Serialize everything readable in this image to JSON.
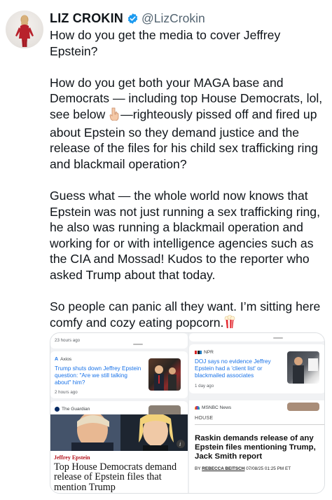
{
  "author": {
    "name": "LIZ CROKIN",
    "handle": "@LizCrokin",
    "verified": true
  },
  "tweet": {
    "paragraphs": [
      "How do you get the media to cover Jeffrey Epstein?",
      "How do you get both your MAGA base and Democrats — including top House Democrats, lol, see below ",
      "Guess what — the whole world now knows that Epstein was not just running a sex trafficking ring, he also was running a blackmail operation and working for or with intelligence agencies such as the CIA and Mossad! Kudos to the reporter who asked Trump about that today.",
      "So people can panic all they want. I’m sitting here comfy and cozy eating popcorn."
    ],
    "para2_tail": "—righteously pissed off and fired up about Epstein so they demand justice and the release of the files for his child sex trafficking ring and blackmail operation?",
    "emoji_pointing": "pointing-down-emoji",
    "emoji_popcorn": "popcorn-emoji"
  },
  "screenshot": {
    "left": {
      "top_time": "23 hours ago",
      "axios": {
        "source": "Axios",
        "headline": "Trump shuts down Jeffrey Epstein question: \"Are we still talking about\" him?",
        "time": "2 hours ago"
      },
      "guardian_source": "The Guardian",
      "article": {
        "kicker": "Jeffrey Epstein",
        "headline": "Top House Democrats demand release of Epstein files that mention Trump"
      }
    },
    "right": {
      "npr": {
        "source": "NPR",
        "headline": "DOJ says no evidence Jeffrey Epstein had a 'client list' or blackmailed associates",
        "time": "1 day ago"
      },
      "msnbc": {
        "source": "MSNBC News",
        "section": "HOUSE",
        "headline": "Raskin demands release of any Epstein files mentioning Trump, Jack Smith report",
        "byline_prefix": "BY",
        "byline_author": "REBECCA BEITSCH",
        "byline_date": "07/08/25 01:25 PM ET"
      }
    }
  },
  "colors": {
    "text": "#0f1419",
    "handle": "#536471",
    "verified": "#1d9bf0",
    "link_blue": "#1a73e8",
    "kicker_red": "#b3121c"
  }
}
